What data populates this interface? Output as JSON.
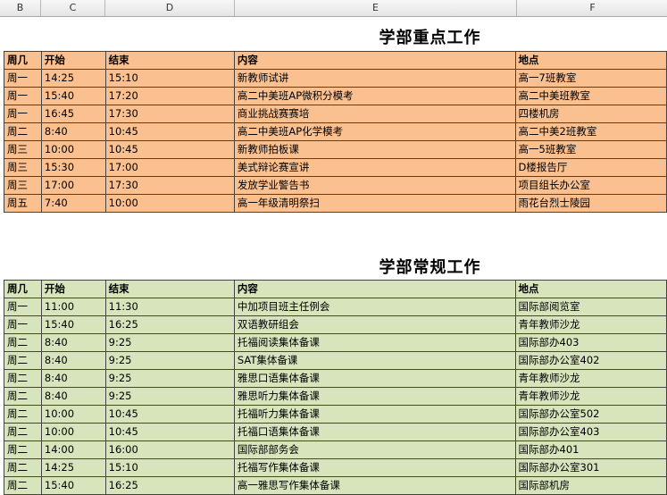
{
  "columns": [
    "B",
    "C",
    "D",
    "E",
    "F"
  ],
  "section1": {
    "title": "学部重点工作",
    "headers": [
      "周几",
      "开始",
      "结束",
      "内容",
      "地点"
    ],
    "rows": [
      [
        "周一",
        "14:25",
        "15:10",
        "新教师试讲",
        "高一7班教室"
      ],
      [
        "周一",
        "15:40",
        "17:20",
        "高二中美班AP微积分模考",
        "高二中美班教室"
      ],
      [
        "周一",
        "16:45",
        "17:30",
        "商业挑战赛赛培",
        "四楼机房"
      ],
      [
        "周二",
        "8:40",
        "10:45",
        "高二中美班AP化学模考",
        "高二中美2班教室"
      ],
      [
        "周三",
        "10:00",
        "10:45",
        "新教师拍板课",
        "高一5班教室"
      ],
      [
        "周三",
        "15:30",
        "17:00",
        "美式辩论赛宣讲",
        "D楼报告厅"
      ],
      [
        "周三",
        "17:00",
        "17:30",
        "发放学业警告书",
        "项目组长办公室"
      ],
      [
        "周五",
        "7:40",
        "10:00",
        "高一年级清明祭扫",
        "雨花台烈士陵园"
      ]
    ]
  },
  "section2": {
    "title": "学部常规工作",
    "headers": [
      "周几",
      "开始",
      "结束",
      "内容",
      "地点"
    ],
    "rows": [
      [
        "周一",
        "11:00",
        "11:30",
        "中加项目班主任例会",
        "国际部阅览室"
      ],
      [
        "周一",
        "15:40",
        "16:25",
        "双语教研组会",
        "青年教师沙龙"
      ],
      [
        "周二",
        "8:40",
        "9:25",
        "托福阅读集体备课",
        "国际部办403"
      ],
      [
        "周二",
        "8:40",
        "9:25",
        "SAT集体备课",
        "国际部办公室402"
      ],
      [
        "周二",
        "8:40",
        "9:25",
        "雅思口语集体备课",
        "青年教师沙龙"
      ],
      [
        "周二",
        "8:40",
        "9:25",
        "雅思听力集体备课",
        "青年教师沙龙"
      ],
      [
        "周二",
        "10:00",
        "10:45",
        "托福听力集体备课",
        "国际部办公室502"
      ],
      [
        "周二",
        "10:00",
        "10:45",
        "托福口语集体备课",
        "国际部办公室403"
      ],
      [
        "周二",
        "14:00",
        "16:00",
        "国际部部务会",
        "国际部办401"
      ],
      [
        "周二",
        "14:25",
        "15:10",
        "托福写作集体备课",
        "国际部办公室301"
      ],
      [
        "周二",
        "15:40",
        "16:25",
        "高一雅思写作集体备课",
        "国际部机房"
      ]
    ]
  },
  "colors": {
    "orange": "#fac090",
    "green": "#d7e4bc"
  }
}
